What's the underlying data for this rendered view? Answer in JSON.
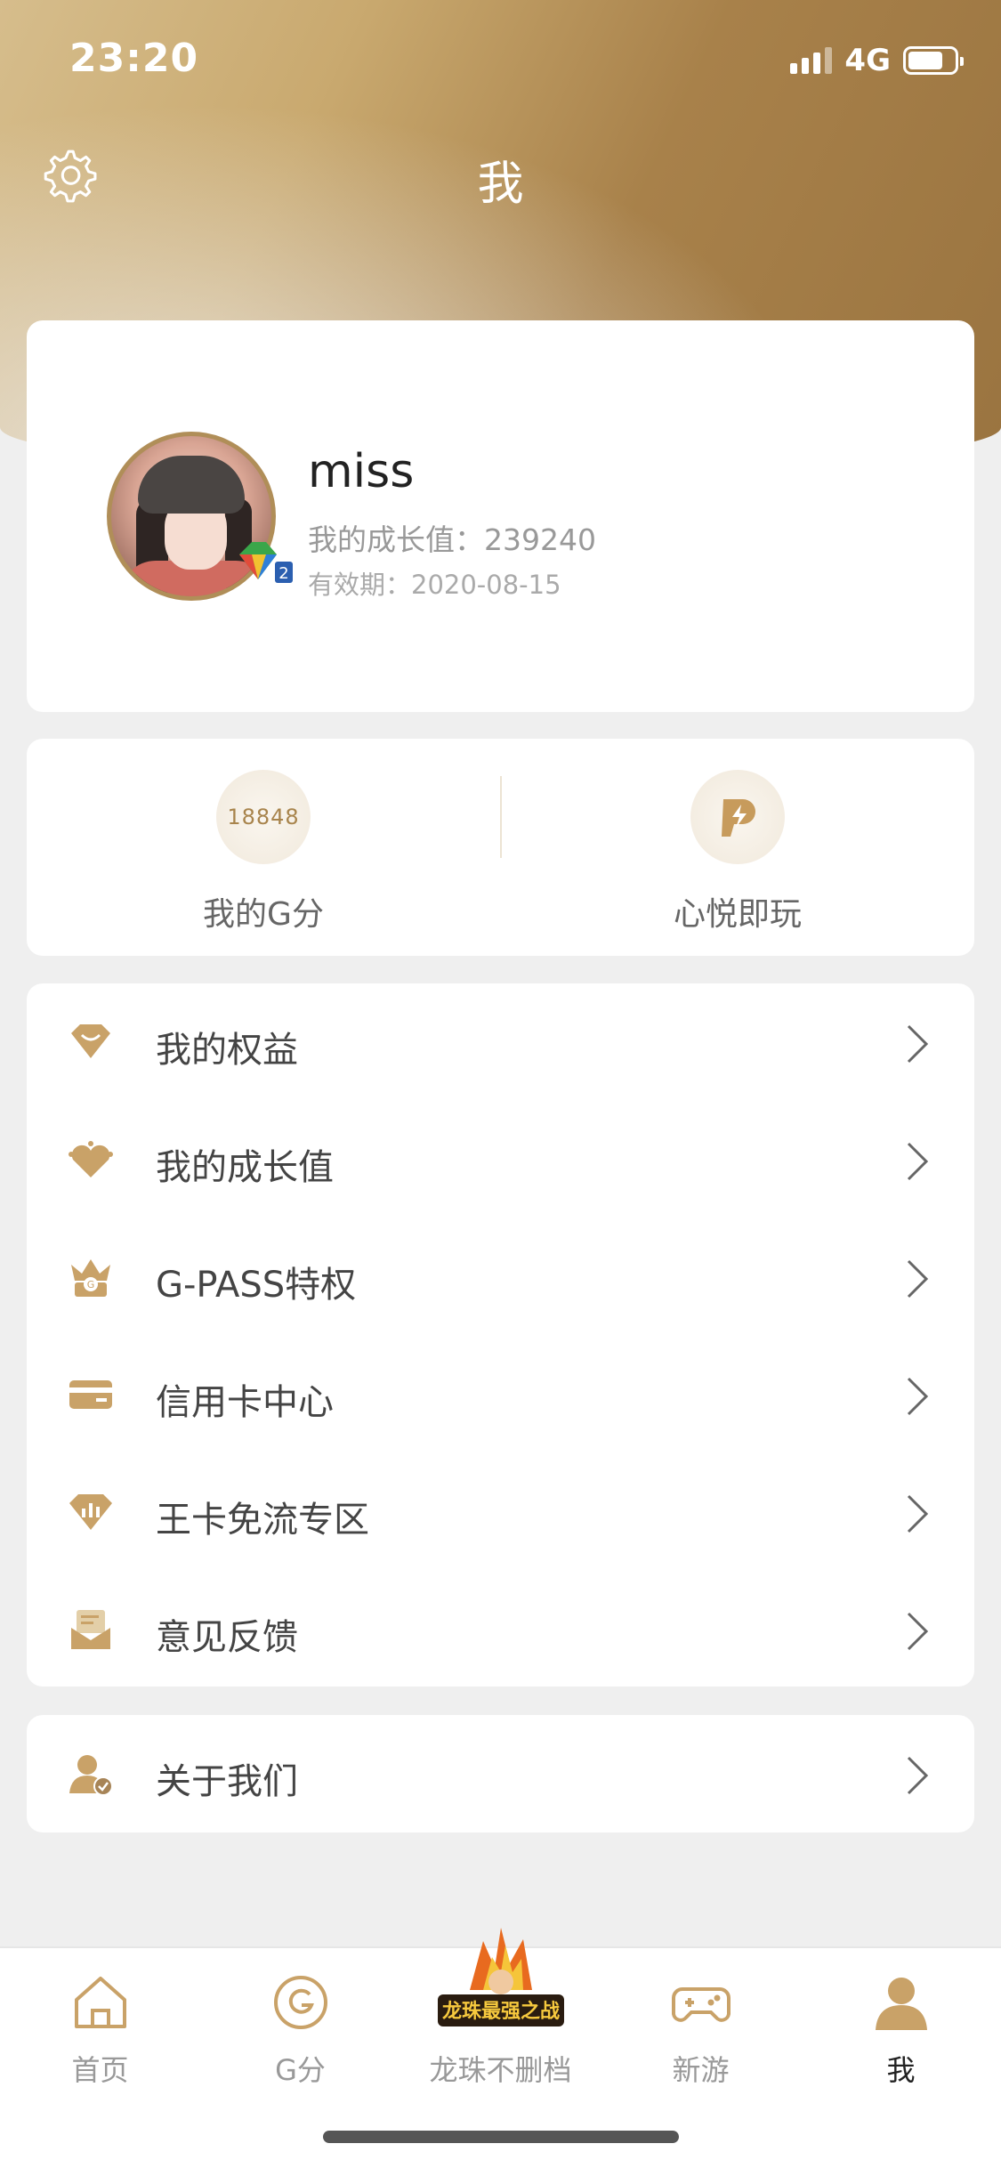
{
  "status_bar": {
    "time": "23:20",
    "network": "4G"
  },
  "nav": {
    "title": "我"
  },
  "profile": {
    "username": "miss",
    "growth_label": "我的成长值：239240",
    "expire_label": "有效期：2020-08-15"
  },
  "quick": {
    "gscore_value": "18848",
    "gscore_label": "我的G分",
    "instant_label": "心悦即玩"
  },
  "menu": [
    {
      "label": "我的权益",
      "icon": "gem-icon"
    },
    {
      "label": "我的成长值",
      "icon": "heart-crown-icon"
    },
    {
      "label": "G-PASS特权",
      "icon": "crown-icon"
    },
    {
      "label": "信用卡中心",
      "icon": "credit-card-icon"
    },
    {
      "label": "王卡免流专区",
      "icon": "data-diamond-icon"
    },
    {
      "label": "意见反馈",
      "icon": "feedback-icon"
    }
  ],
  "about": {
    "label": "关于我们",
    "icon": "user-check-icon"
  },
  "tabs": [
    {
      "label": "首页",
      "icon": "home-icon",
      "active": false
    },
    {
      "label": "G分",
      "icon": "g-coin-icon",
      "active": false
    },
    {
      "label": "龙珠不删档",
      "icon": "dragonball-promo-icon",
      "active": false,
      "promo_text": "龙珠最强之战"
    },
    {
      "label": "新游",
      "icon": "gamepad-icon",
      "active": false
    },
    {
      "label": "我",
      "icon": "profile-icon",
      "active": true
    }
  ],
  "colors": {
    "gold": "#b08e58",
    "header_dark": "#9a7440",
    "header_light": "#d6bd8c",
    "background": "#efefef"
  }
}
